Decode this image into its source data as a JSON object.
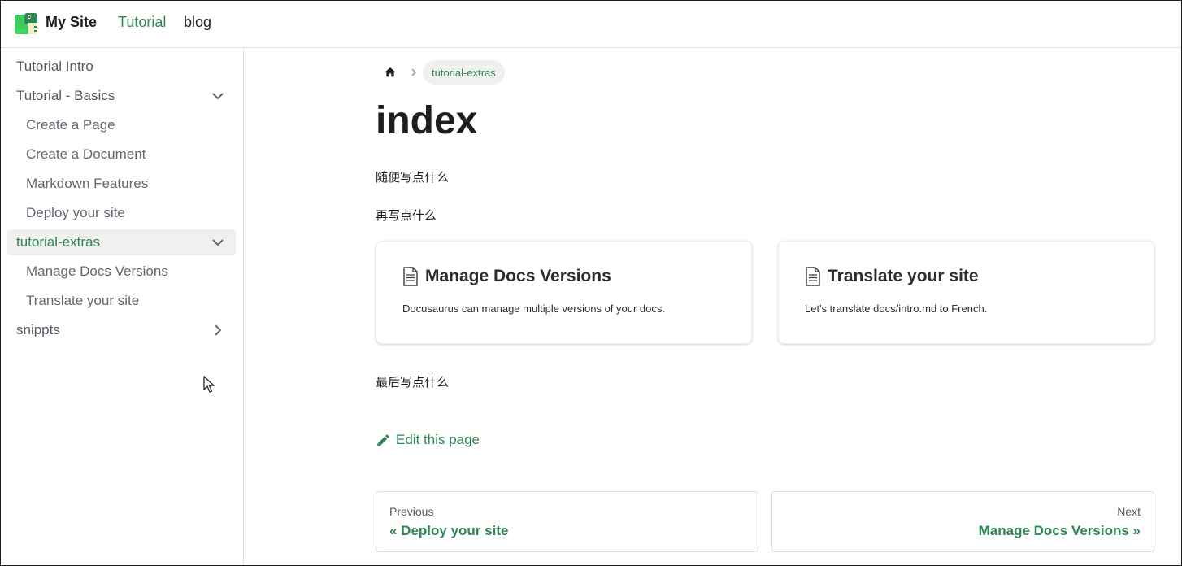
{
  "navbar": {
    "site_title": "My Site",
    "links": [
      {
        "label": "Tutorial",
        "active": true
      },
      {
        "label": "blog",
        "active": false
      }
    ]
  },
  "sidebar": {
    "items": [
      {
        "label": "Tutorial Intro",
        "level": 0
      },
      {
        "label": "Tutorial - Basics",
        "level": 0,
        "caret": "chevron-down"
      },
      {
        "label": "Create a Page",
        "level": 1
      },
      {
        "label": "Create a Document",
        "level": 1
      },
      {
        "label": "Markdown Features",
        "level": 1
      },
      {
        "label": "Deploy your site",
        "level": 1
      },
      {
        "label": "tutorial-extras",
        "level": 0,
        "caret": "chevron-down",
        "active": true
      },
      {
        "label": "Manage Docs Versions",
        "level": 1
      },
      {
        "label": "Translate your site",
        "level": 1
      },
      {
        "label": "snippts",
        "level": 0,
        "caret": "chevron-right"
      }
    ]
  },
  "breadcrumb": {
    "home_icon": "home-icon",
    "current": "tutorial-extras"
  },
  "doc": {
    "title": "index",
    "paragraphs": [
      "随便写点什么",
      "再写点什么",
      "最后写点什么"
    ],
    "cards": [
      {
        "icon": "document-icon",
        "title": "Manage Docs Versions",
        "description": "Docusaurus can manage multiple versions of your docs."
      },
      {
        "icon": "document-icon",
        "title": "Translate your site",
        "description": "Let's translate docs/intro.md to French."
      }
    ],
    "edit_link": "Edit this page"
  },
  "pagination": {
    "previous": {
      "sublabel": "Previous",
      "label": "« Deploy your site"
    },
    "next": {
      "sublabel": "Next",
      "label": "Manage Docs Versions »"
    }
  },
  "colors": {
    "accent": "#2e8555",
    "text": "#1c1e21",
    "active_bg": "#f0f0f0",
    "border": "#e3e3e3"
  }
}
